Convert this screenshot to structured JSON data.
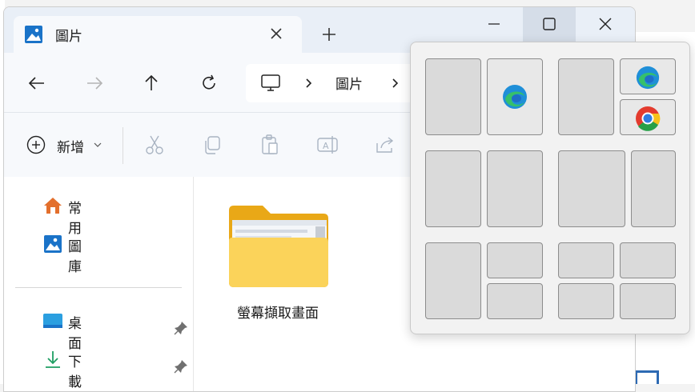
{
  "window": {
    "tab_title": "圖片",
    "new_tab_symbol": "+"
  },
  "address": {
    "crumb": "圖片"
  },
  "toolbar": {
    "new_label": "新增"
  },
  "sidebar": {
    "items": [
      {
        "label": "常用",
        "icon": "home-icon"
      },
      {
        "label": "圖庫",
        "icon": "gallery-icon"
      },
      {
        "label": "桌面",
        "icon": "desktop-icon"
      },
      {
        "label": "下載",
        "icon": "download-icon"
      }
    ]
  },
  "content": {
    "folder_label": "螢幕擷取畫面"
  },
  "snap_layouts": {
    "apps": [
      "edge-icon",
      "chrome-icon"
    ]
  },
  "colors": {
    "accent": "#0067c0",
    "folder": "#f5c12e",
    "titlebar": "#e9eff7"
  }
}
